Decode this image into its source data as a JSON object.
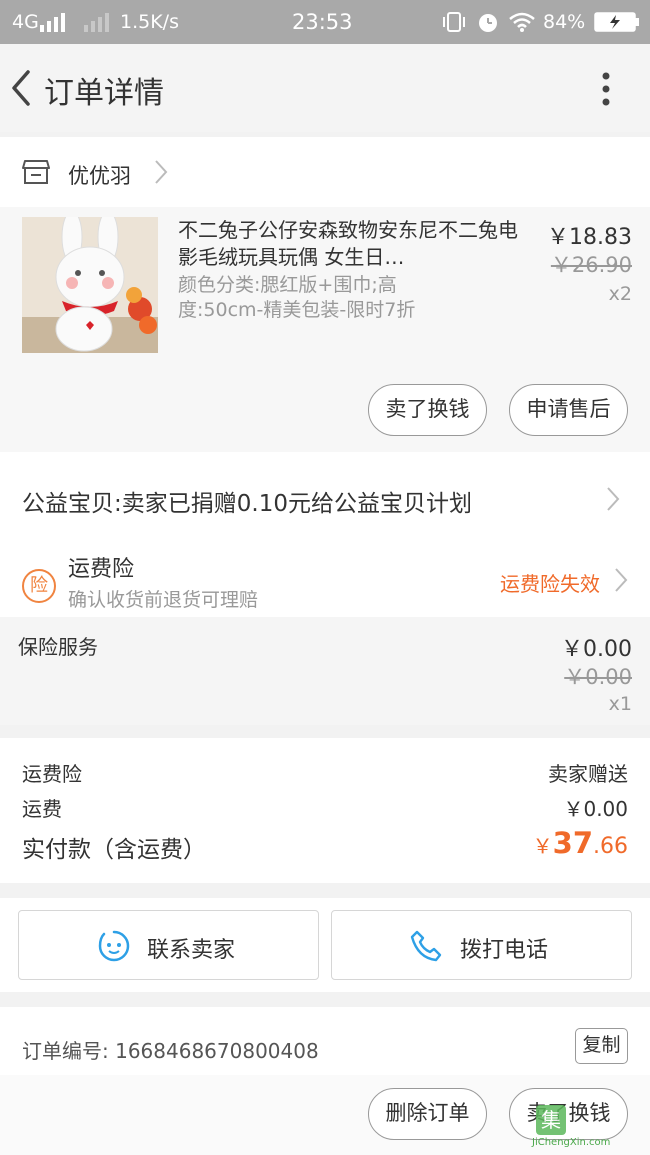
{
  "status_bar": {
    "network": "4G",
    "speed": "1.5K/s",
    "time": "23:53",
    "battery": "84%"
  },
  "header": {
    "title": "订单详情"
  },
  "shop": {
    "name": "优优羽"
  },
  "product": {
    "title": "不二兔子公仔安森致物安东尼不二兔电影毛绒玩具玩偶 女生日…",
    "spec": "颜色分类:腮红版+围巾;高度:50cm-精美包装-限时7折",
    "price": "￥18.83",
    "original_price": "￥26.90",
    "quantity": "x2",
    "buttons": {
      "sell": "卖了换钱",
      "after_sale": "申请售后"
    }
  },
  "charity": {
    "text": "公益宝贝:卖家已捐赠0.10元给公益宝贝计划"
  },
  "shipping_insurance": {
    "badge": "险",
    "title": "运费险",
    "subtitle": "确认收货前退货可理赔",
    "status": "运费险失效"
  },
  "insurance_service": {
    "label": "保险服务",
    "price": "￥0.00",
    "original_price": "￥0.00",
    "quantity": "x1"
  },
  "summary": {
    "rows": [
      {
        "label": "运费险",
        "value": "卖家赠送"
      },
      {
        "label": "运费",
        "value": "￥0.00"
      }
    ],
    "total_label": "实付款（含运费）",
    "total_currency": "￥",
    "total_int": "37",
    "total_dec": ".66"
  },
  "actions": {
    "contact_seller": "联系卖家",
    "call": "拨打电话"
  },
  "order": {
    "number_label": "订单编号:",
    "number": "1668468670800408",
    "copy": "复制"
  },
  "footer": {
    "delete": "删除订单",
    "sell": "卖了换钱"
  },
  "watermark": {
    "text": "JiChengXin.com",
    "logo_char": "集"
  },
  "colors": {
    "accent": "#f06a2a",
    "icon_blue": "#2ea0e6",
    "status_bar": "#a9a9a9"
  }
}
